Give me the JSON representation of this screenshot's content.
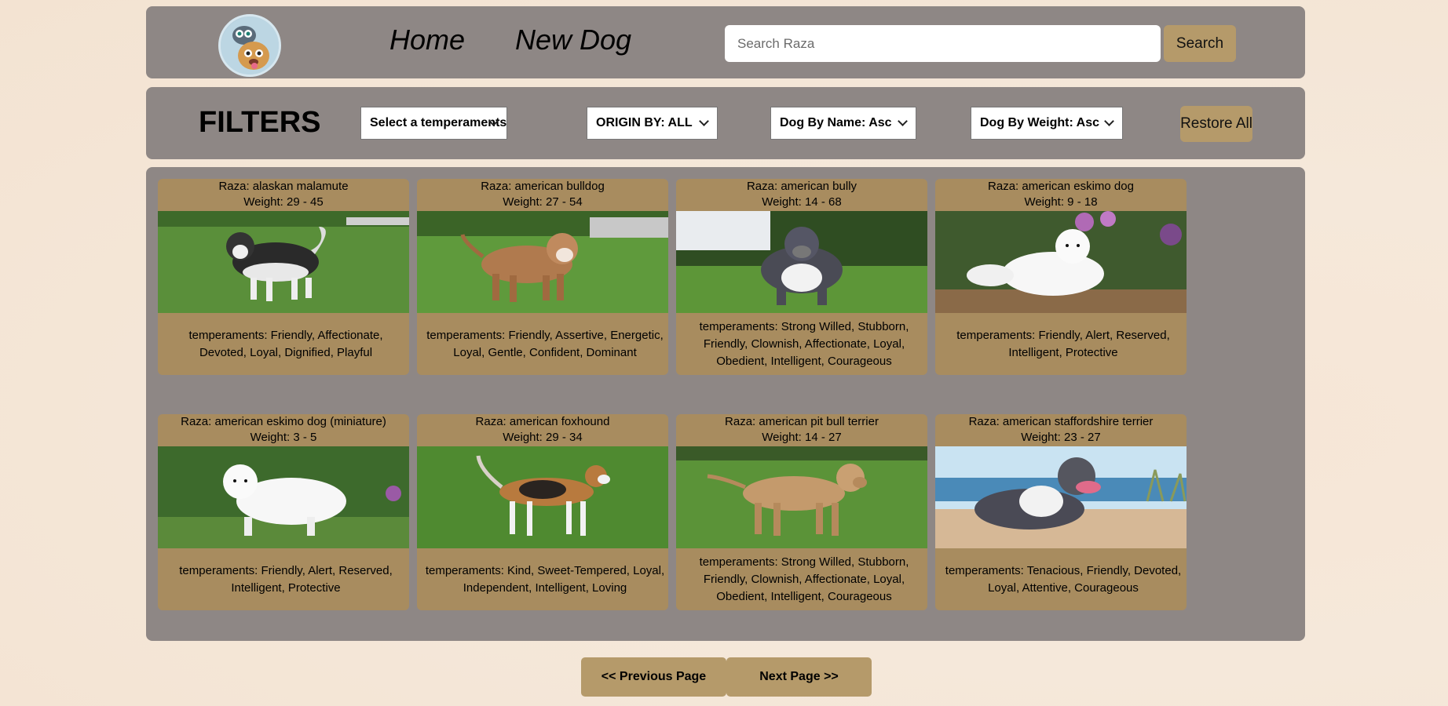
{
  "nav": {
    "home_label": "Home",
    "new_dog_label": "New Dog",
    "search_placeholder": "Search Raza",
    "search_button": "Search"
  },
  "filters": {
    "title": "FILTERS",
    "temperament_select": "Select a temperaments",
    "origin_select": "ORIGIN BY: ALL",
    "name_sort_select": "Dog By Name: Asc",
    "weight_sort_select": "Dog By Weight: Asc",
    "restore_button": "Restore All"
  },
  "cards": [
    {
      "raza": "Raza: alaskan malamute",
      "weight": "Weight: 29 - 45",
      "temperaments": "temperaments: Friendly, Affectionate, Devoted, Loyal, Dignified, Playful"
    },
    {
      "raza": "Raza: american bulldog",
      "weight": "Weight: 27 - 54",
      "temperaments": "temperaments: Friendly, Assertive, Energetic, Loyal, Gentle, Confident, Dominant"
    },
    {
      "raza": "Raza: american bully",
      "weight": "Weight: 14 - 68",
      "temperaments": "temperaments: Strong Willed, Stubborn, Friendly, Clownish, Affectionate, Loyal, Obedient, Intelligent, Courageous"
    },
    {
      "raza": "Raza: american eskimo dog",
      "weight": "Weight: 9 - 18",
      "temperaments": "temperaments: Friendly, Alert, Reserved, Intelligent, Protective"
    },
    {
      "raza": "Raza: american eskimo dog (miniature)",
      "weight": "Weight: 3 - 5",
      "temperaments": "temperaments: Friendly, Alert, Reserved, Intelligent, Protective"
    },
    {
      "raza": "Raza: american foxhound",
      "weight": "Weight: 29 - 34",
      "temperaments": "temperaments: Kind, Sweet-Tempered, Loyal, Independent, Intelligent, Loving"
    },
    {
      "raza": "Raza: american pit bull terrier",
      "weight": "Weight: 14 - 27",
      "temperaments": "temperaments: Strong Willed, Stubborn, Friendly, Clownish, Affectionate, Loyal, Obedient, Intelligent, Courageous"
    },
    {
      "raza": "Raza: american staffordshire terrier",
      "weight": "Weight: 23 - 27",
      "temperaments": "temperaments: Tenacious, Friendly, Devoted, Loyal, Attentive, Courageous"
    }
  ],
  "pagination": {
    "prev_label": "<< Previous Page",
    "next_label": "Next Page >>"
  }
}
